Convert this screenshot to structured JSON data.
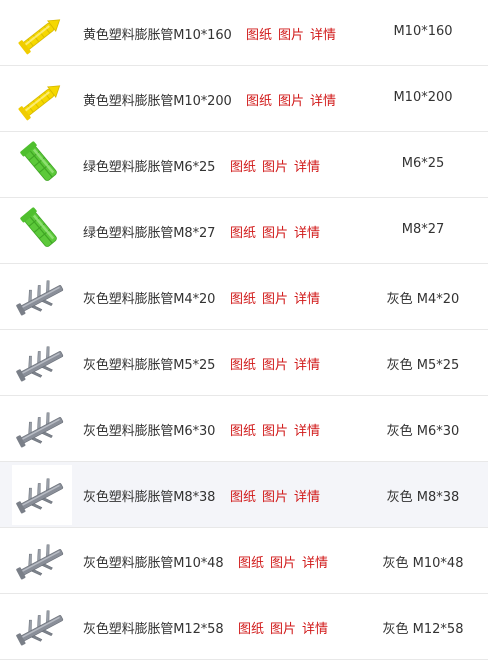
{
  "links": {
    "drawing": "图纸",
    "photo": "图片",
    "details": "详情"
  },
  "rows": [
    {
      "name": "黄色塑料膨胀管M10*160",
      "spec": "M10*160",
      "icon": "yellow-anchor-icon"
    },
    {
      "name": "黄色塑料膨胀管M10*200",
      "spec": "M10*200",
      "icon": "yellow-anchor-icon"
    },
    {
      "name": "绿色塑料膨胀管M6*25",
      "spec": "M6*25",
      "icon": "green-anchor-icon"
    },
    {
      "name": "绿色塑料膨胀管M8*27",
      "spec": "M8*27",
      "icon": "green-anchor-icon"
    },
    {
      "name": "灰色塑料膨胀管M4*20",
      "spec": "灰色 M4*20",
      "icon": "gray-anchor-icon"
    },
    {
      "name": "灰色塑料膨胀管M5*25",
      "spec": "灰色 M5*25",
      "icon": "gray-anchor-icon"
    },
    {
      "name": "灰色塑料膨胀管M6*30",
      "spec": "灰色 M6*30",
      "icon": "gray-anchor-icon"
    },
    {
      "name": "灰色塑料膨胀管M8*38",
      "spec": "灰色 M8*38",
      "icon": "gray-anchor-icon"
    },
    {
      "name": "灰色塑料膨胀管M10*48",
      "spec": "灰色 M10*48",
      "icon": "gray-anchor-icon"
    },
    {
      "name": "灰色塑料膨胀管M12*58",
      "spec": "灰色 M12*58",
      "icon": "gray-anchor-icon"
    }
  ],
  "colors": {
    "link": "#d11a1a",
    "yellow": "#f5d800",
    "green": "#5cc93a",
    "gray": "#8a8f99",
    "highlight_row": "#f4f5f9"
  },
  "highlighted_row": 7
}
